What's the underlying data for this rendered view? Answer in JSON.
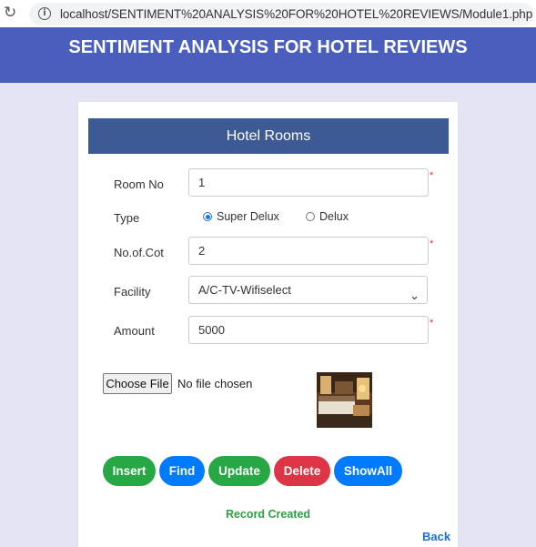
{
  "browser": {
    "url": "localhost/SENTIMENT%20ANALYSIS%20FOR%20HOTEL%20REVIEWS/Module1.php"
  },
  "header": {
    "title": "SENTIMENT ANALYSIS FOR HOTEL REVIEWS"
  },
  "form": {
    "title": "Hotel Rooms",
    "room_no": {
      "label": "Room No",
      "value": "1"
    },
    "type": {
      "label": "Type",
      "options": [
        "Super Delux",
        "Delux"
      ],
      "selected": "Super Delux"
    },
    "cot": {
      "label": "No.of.Cot",
      "value": "2"
    },
    "facility": {
      "label": "Facility",
      "value": "A/C-TV-Wifiselect"
    },
    "amount": {
      "label": "Amount",
      "value": "5000"
    },
    "required_mark": "*",
    "file": {
      "button_label": "Choose File",
      "status": "No file chosen"
    }
  },
  "actions": {
    "insert": "Insert",
    "find": "Find",
    "update": "Update",
    "delete": "Delete",
    "show_all": "ShowAll"
  },
  "status_message": "Record Created",
  "back_link": "Back",
  "colors": {
    "header_bg": "#4a5fbd",
    "card_header_bg": "#3e5a94",
    "green": "#28a745",
    "blue": "#007bff",
    "red": "#dc3545"
  }
}
